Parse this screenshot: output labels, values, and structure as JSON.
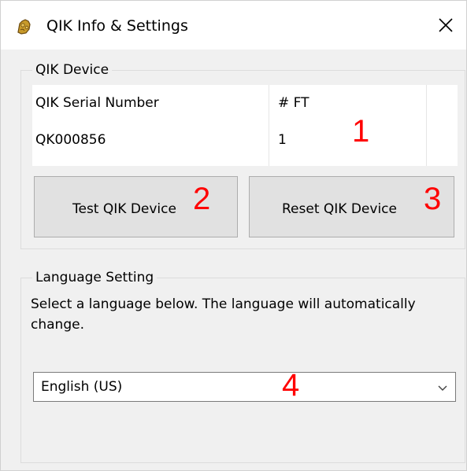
{
  "window": {
    "title": "QIK Info & Settings",
    "icon": "gold-app-icon",
    "close_icon": "close-icon"
  },
  "qik_device": {
    "group_label": "QIK Device",
    "columns": [
      "QIK Serial Number",
      "# FT"
    ],
    "rows": [
      [
        "QK000856",
        "1"
      ]
    ],
    "test_button_label": "Test QIK Device",
    "reset_button_label": "Reset QIK Device"
  },
  "language": {
    "group_label": "Language Setting",
    "description": "Select a language below. The language will automatically change.",
    "selected": "English (US)",
    "arrow_icon": "chevron-down-icon"
  },
  "annotations": [
    "1",
    "2",
    "3",
    "4"
  ],
  "colors": {
    "annotation": "#ff0000",
    "window_bg": "#f0f0f0",
    "button_bg": "#e1e1e1"
  }
}
